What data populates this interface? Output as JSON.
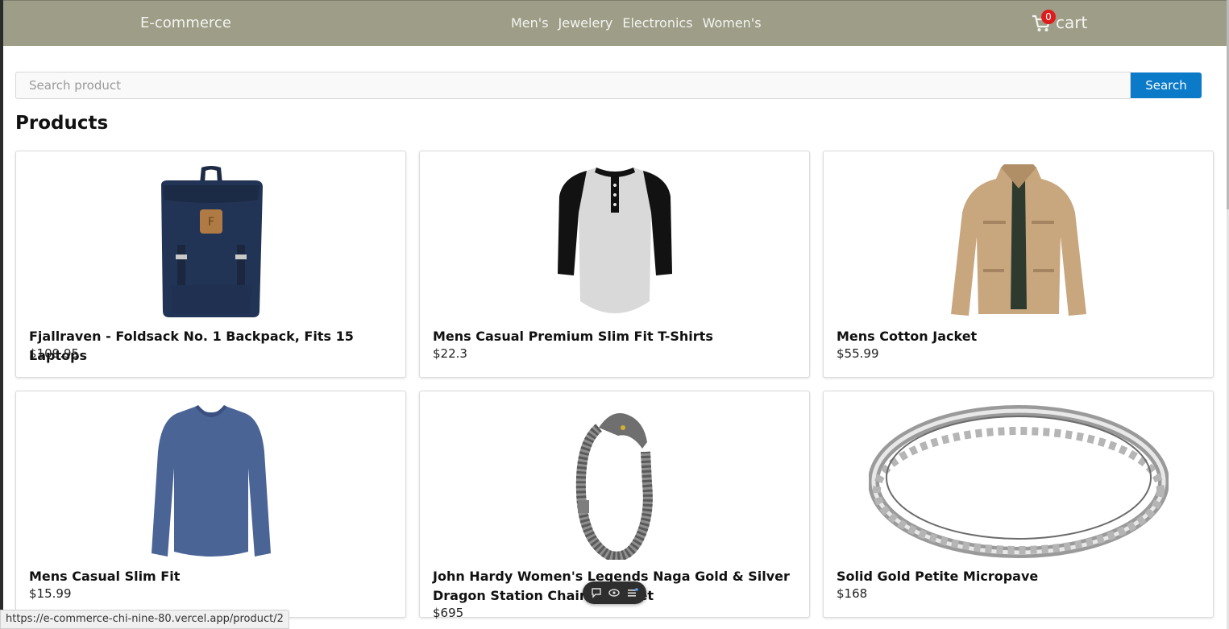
{
  "navbar": {
    "brand": "E-commerce",
    "links": [
      "Men's",
      "Jewelery",
      "Electronics",
      "Women's"
    ],
    "cart_count": "0",
    "cart_label": "cart"
  },
  "search": {
    "placeholder": "Search product",
    "value": "",
    "button_label": "Search"
  },
  "main": {
    "title": "Products",
    "products": [
      {
        "name": "Fjallraven - Foldsack No. 1 Backpack, Fits 15 Laptops",
        "price": "$109.95",
        "image_icon": "backpack-image"
      },
      {
        "name": "Mens Casual Premium Slim Fit T-Shirts",
        "price": "$22.3",
        "image_icon": "tshirt-image"
      },
      {
        "name": "Mens Cotton Jacket",
        "price": "$55.99",
        "image_icon": "jacket-image"
      },
      {
        "name": "Mens Casual Slim Fit",
        "price": "$15.99",
        "image_icon": "longsleeve-shirt-image"
      },
      {
        "name": "John Hardy Women's Legends Naga Gold & Silver Dragon Station Chain Bracelet",
        "price": "$695",
        "image_icon": "bracelet-image"
      },
      {
        "name": "Solid Gold Petite Micropave",
        "price": "$168",
        "image_icon": "ring-image"
      }
    ]
  },
  "status_bar": {
    "url": "https://e-commerce-chi-nine-80.vercel.app/product/2"
  },
  "colors": {
    "navbar_bg": "#9e9d88",
    "search_button": "#0a7ac9",
    "cart_badge": "#e01b1b"
  }
}
